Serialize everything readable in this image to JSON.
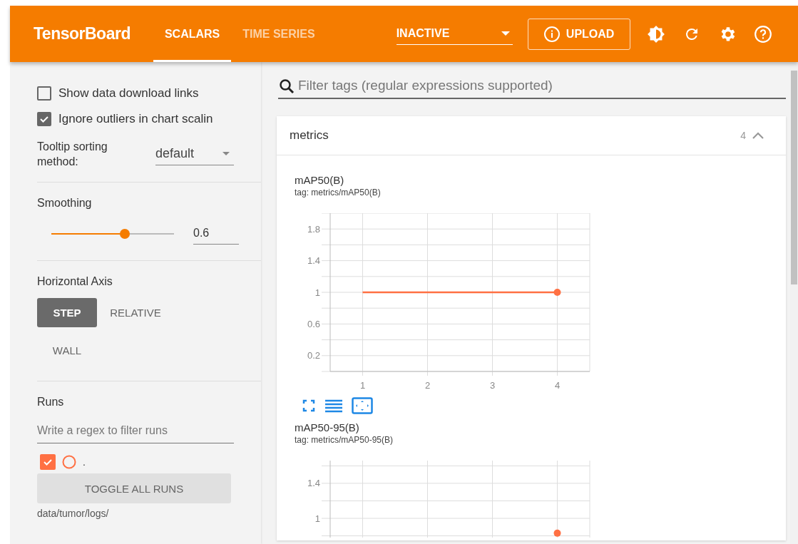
{
  "header": {
    "logo": "TensorBoard",
    "tabs": [
      {
        "label": "SCALARS",
        "selected": true
      },
      {
        "label": "TIME SERIES",
        "selected": false
      }
    ],
    "run_select": {
      "value": "INACTIVE"
    },
    "upload_button": "UPLOAD"
  },
  "sidebar": {
    "options": [
      {
        "label": "Show data download links",
        "checked": false
      },
      {
        "label": "Ignore outliers in chart scalin",
        "checked": true
      }
    ],
    "tooltip_sorting": {
      "label": "Tooltip sorting method:",
      "value": "default"
    },
    "smoothing": {
      "label": "Smoothing",
      "level": 0.6,
      "value": "0.6"
    },
    "horizontal_axis": {
      "label": "Horizontal Axis",
      "options": [
        {
          "label": "STEP",
          "selected": true
        },
        {
          "label": "RELATIVE",
          "selected": false
        },
        {
          "label": "WALL",
          "selected": false
        }
      ]
    },
    "runs": {
      "label": "Runs",
      "filter_placeholder": "Write a regex to filter runs",
      "items": [
        {
          "label": ".",
          "checked": true,
          "color": "#ff7043"
        }
      ],
      "toggle_button": "TOGGLE ALL RUNS",
      "path": "data/tumor/logs/"
    }
  },
  "main": {
    "filter": {
      "placeholder": "Filter tags (regular expressions supported)"
    },
    "groups": [
      {
        "name": "metrics",
        "count": "4",
        "expanded": true,
        "cards": [
          {
            "title": "mAP50(B)",
            "tag": "tag: metrics/mAP50(B)",
            "chart_data": {
              "type": "line",
              "x": [
                1,
                2,
                3,
                4
              ],
              "xlim": [
                0.5,
                4.5
              ],
              "ylim": [
                0,
                2
              ],
              "xticks": [
                1,
                2,
                3,
                4
              ],
              "yticks": [
                0.2,
                0.6,
                1,
                1.4,
                1.8
              ],
              "grid": true,
              "series": [
                {
                  "color": "#ff7043",
                  "marker": true,
                  "values": [
                    1,
                    1,
                    1,
                    1
                  ]
                }
              ]
            }
          },
          {
            "title": "mAP50-95(B)",
            "tag": "tag: metrics/mAP50-95(B)",
            "chart_data": {
              "type": "line",
              "ylim": [
                0.78,
                1.66
              ],
              "yticks": [
                1,
                1.4
              ],
              "grid": true,
              "series": [
                {
                  "color": "#ff7043",
                  "marker": true,
                  "values": [
                    null,
                    null,
                    null,
                    0.83
                  ]
                }
              ]
            }
          }
        ]
      }
    ]
  }
}
